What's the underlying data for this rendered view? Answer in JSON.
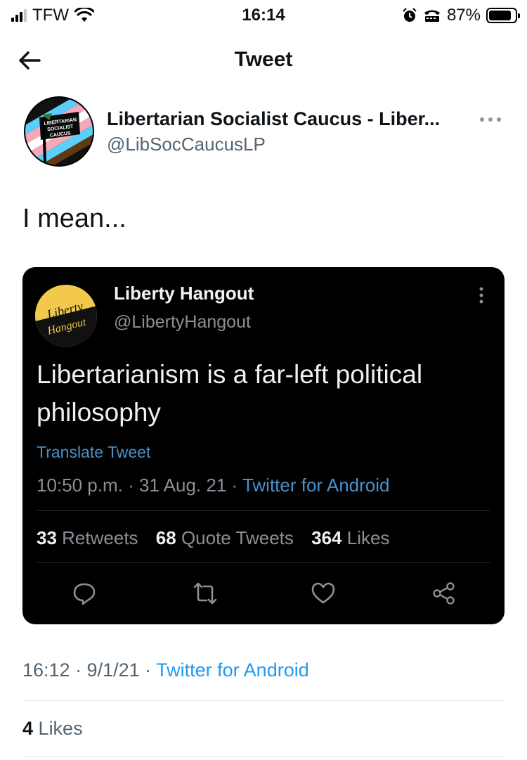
{
  "status_bar": {
    "carrier": "TFW",
    "time": "16:14",
    "battery": "87%",
    "battery_level": 0.87
  },
  "header": {
    "title": "Tweet"
  },
  "author": {
    "name": "Libertarian Socialist Caucus - Liber...",
    "handle": "@LibSocCaucusLP",
    "avatar_text": [
      "LIBERTARIAN",
      "SOCIALIST",
      "CAUCUS"
    ]
  },
  "tweet": {
    "text": "I mean...",
    "timestamp": "16:12 · 9/1/21 · ",
    "source": "Twitter for Android",
    "likes_count": "4",
    "likes_label": "Likes"
  },
  "embedded": {
    "name": "Liberty Hangout",
    "handle": "@LibertyHangout",
    "avatar_text": [
      "Liberty",
      "Hangout"
    ],
    "text": "Libertarianism is a far-left political philosophy",
    "translate": "Translate Tweet",
    "meta": "10:50 p.m. · 31 Aug. 21 · ",
    "source": "Twitter for Android",
    "retweets_count": "33",
    "retweets_label": "Retweets",
    "quotes_count": "68",
    "quotes_label": "Quote Tweets",
    "likes_count": "364",
    "likes_label": "Likes"
  },
  "colors": {
    "link": "#1d9bf0",
    "embed_bg": "#000000",
    "muted": "#536471"
  }
}
